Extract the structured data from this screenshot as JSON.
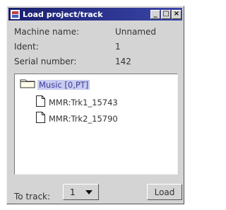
{
  "window": {
    "title": "Load project/track",
    "controls": {
      "minimize": "_",
      "maximize": "□",
      "close": "×"
    }
  },
  "info": [
    {
      "label": "Machine name:",
      "value": "Unnamed"
    },
    {
      "label": "Ident:",
      "value": "1"
    },
    {
      "label": "Serial number:",
      "value": "142"
    }
  ],
  "tree": {
    "root": {
      "label": "Music [0,PT]",
      "icon": "folder-icon"
    },
    "items": [
      {
        "label": "MMR:Trk1_15743",
        "icon": "file-icon"
      },
      {
        "label": "MMR:Trk2_15790",
        "icon": "file-icon"
      }
    ]
  },
  "footer": {
    "to_track_label": "To track:",
    "track_value": "1",
    "load_label": "Load"
  },
  "colors": {
    "titlebar": "#1a1f6e",
    "selection": "#c9ccf0",
    "window_bg": "#d4d4d4"
  }
}
